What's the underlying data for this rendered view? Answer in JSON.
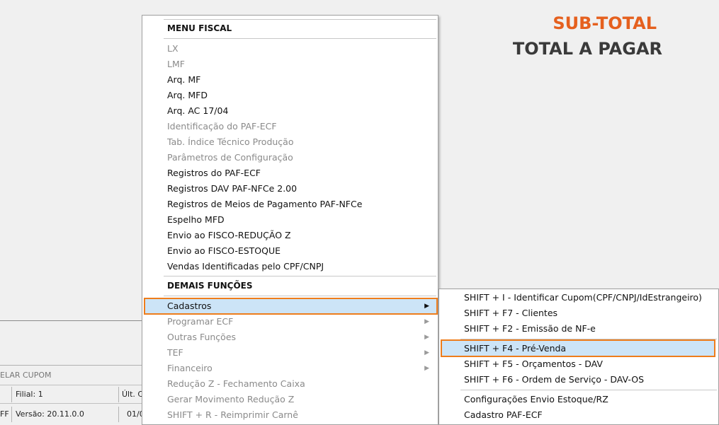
{
  "totals": {
    "sub_total_label": "SUB-TOTAL",
    "total_pagar_label": "TOTAL A PAGAR",
    "sub_total_color": "#e5601e",
    "total_color": "#3a3a3a"
  },
  "bottom": {
    "cancel_label": "ELAR CUPOM",
    "row1": {
      "left_prefix": "",
      "filial": "Filial: 1",
      "ult": "Últ. C"
    },
    "row2": {
      "left_prefix": "FF",
      "versao": "Versão: 20.11.0.0",
      "date": "01/0"
    }
  },
  "menu": {
    "section1_header": "MENU FISCAL",
    "section1_items": [
      {
        "label": "LX",
        "enabled": false
      },
      {
        "label": "LMF",
        "enabled": false
      },
      {
        "label": "Arq. MF",
        "enabled": true
      },
      {
        "label": "Arq. MFD",
        "enabled": true
      },
      {
        "label": "Arq. AC 17/04",
        "enabled": true
      },
      {
        "label": "Identificação do PAF-ECF",
        "enabled": false
      },
      {
        "label": "Tab. Índice Técnico Produção",
        "enabled": false
      },
      {
        "label": "Parâmetros de Configuração",
        "enabled": false
      },
      {
        "label": "Registros do PAF-ECF",
        "enabled": true
      },
      {
        "label": "Registros DAV PAF-NFCe 2.00",
        "enabled": true
      },
      {
        "label": "Registros de Meios de Pagamento PAF-NFCe",
        "enabled": true
      },
      {
        "label": "Espelho MFD",
        "enabled": true
      },
      {
        "label": "Envio ao FISCO-REDUÇÃO Z",
        "enabled": true
      },
      {
        "label": "Envio ao FISCO-ESTOQUE",
        "enabled": true
      },
      {
        "label": "Vendas Identificadas pelo CPF/CNPJ",
        "enabled": true
      }
    ],
    "section2_header": "DEMAIS FUNÇÕES",
    "section2_items": [
      {
        "label": "Cadastros",
        "enabled": true,
        "submenu": true,
        "highlighted": true
      },
      {
        "label": "Programar ECF",
        "enabled": false,
        "submenu": true
      },
      {
        "label": "Outras Funções",
        "enabled": false,
        "submenu": true
      },
      {
        "label": "TEF",
        "enabled": false,
        "submenu": true
      },
      {
        "label": "Financeiro",
        "enabled": false,
        "submenu": true
      },
      {
        "label": "Redução Z - Fechamento Caixa",
        "enabled": false
      },
      {
        "label": "Gerar Movimento Redução Z",
        "enabled": false
      },
      {
        "label": "SHIFT + R - Reimprimir Carnê",
        "enabled": false
      }
    ],
    "arrow_glyph": "▶"
  },
  "submenu": {
    "group1": [
      "SHIFT + I - Identificar Cupom(CPF/CNPJ/IdEstrangeiro)",
      "SHIFT + F7 - Clientes",
      "SHIFT + F2 - Emissão de NF-e"
    ],
    "group2": [
      "SHIFT + F4 - Pré-Venda",
      "SHIFT + F5 - Orçamentos - DAV",
      "SHIFT + F6 - Ordem de Serviço - DAV-OS"
    ],
    "group3": [
      "Configurações Envio Estoque/RZ",
      "Cadastro PAF-ECF"
    ],
    "highlighted": "SHIFT + F4 - Pré-Venda",
    "highlight_border_color": "#ee7d1c",
    "highlight_fill_color": "#cce4f7"
  }
}
